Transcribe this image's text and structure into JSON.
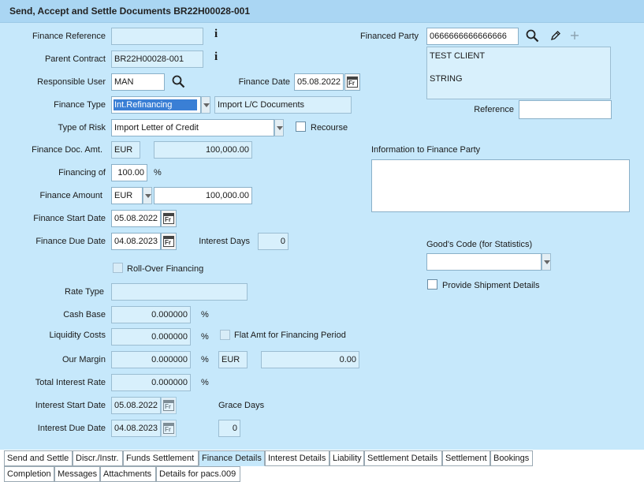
{
  "window": {
    "title": "Send, Accept and Settle Documents BR22H00028-001"
  },
  "form": {
    "finance_reference": {
      "label": "Finance Reference",
      "value": ""
    },
    "parent_contract": {
      "label": "Parent Contract",
      "value": "BR22H00028-001"
    },
    "responsible_user": {
      "label": "Responsible User",
      "value": "MAN"
    },
    "finance_date": {
      "label": "Finance Date",
      "value": "05.08.2022"
    },
    "finance_type": {
      "label": "Finance Type",
      "value": "Int.Refinancing",
      "description": "Import L/C Documents"
    },
    "type_of_risk": {
      "label": "Type of Risk",
      "value": "Import Letter of Credit"
    },
    "recourse": {
      "label": "Recourse"
    },
    "finance_doc_amt": {
      "label": "Finance Doc. Amt.",
      "currency": "EUR",
      "amount": "100,000.00"
    },
    "financing_of": {
      "label": "Financing of",
      "value": "100.00",
      "unit": "%"
    },
    "finance_amount": {
      "label": "Finance Amount",
      "currency": "EUR",
      "amount": "100,000.00"
    },
    "finance_start_date": {
      "label": "Finance Start Date",
      "value": "05.08.2022"
    },
    "finance_due_date": {
      "label": "Finance Due Date",
      "value": "04.08.2023"
    },
    "interest_days": {
      "label": "Interest Days",
      "value": "0"
    },
    "roll_over": {
      "label": "Roll-Over Financing"
    },
    "rate_type": {
      "label": "Rate Type",
      "value": ""
    },
    "cash_base": {
      "label": "Cash Base",
      "value": "0.000000",
      "unit": "%"
    },
    "liquidity_costs": {
      "label": "Liquidity Costs",
      "value": "0.000000",
      "unit": "%"
    },
    "flat_amt": {
      "label": "Flat Amt for Financing Period"
    },
    "our_margin": {
      "label": "Our Margin",
      "value": "0.000000",
      "unit": "%",
      "currency": "EUR",
      "amount": "0.00"
    },
    "total_interest_rate": {
      "label": "Total Interest Rate",
      "value": "0.000000",
      "unit": "%"
    },
    "interest_start_date": {
      "label": "Interest Start Date",
      "value": "05.08.2022"
    },
    "interest_due_date": {
      "label": "Interest Due Date",
      "value": "04.08.2023"
    },
    "grace_days": {
      "label": "Grace Days",
      "value": "0"
    },
    "financed_party": {
      "label": "Financed Party",
      "value": "0666666666666666",
      "address_line1": "TEST CLIENT",
      "address_line2": "STRING"
    },
    "reference": {
      "label": "Reference",
      "value": ""
    },
    "info_to_finance_party": {
      "label": "Information to Finance Party",
      "value": ""
    },
    "goods_code": {
      "label": "Good's Code (for Statistics)",
      "value": ""
    },
    "provide_shipment": {
      "label": "Provide Shipment Details"
    }
  },
  "calendar_glyph": "Fr",
  "info_glyph": "i",
  "tabs_row1": [
    "Send and Settle",
    "Discr./Instr.",
    "Funds Settlement",
    "Finance Details",
    "Interest Details",
    "Liability",
    "Settlement Details",
    "Settlement",
    "Bookings"
  ],
  "tabs_row2": [
    "Completion",
    "Messages",
    "Attachments",
    "Details for pacs.009"
  ],
  "active_tab": "Finance Details",
  "icons": {
    "search": "magnifier-icon",
    "edit": "pencil-icon",
    "add": "plus-icon",
    "info": "info-icon",
    "calendar": "calendar-icon"
  },
  "colors": {
    "panel": "#c6e8fb",
    "titlebar": "#aad6f3",
    "field_disabled": "#d8f0fc",
    "field_enabled": "#ffffff",
    "selection": "#3a7fd5"
  }
}
